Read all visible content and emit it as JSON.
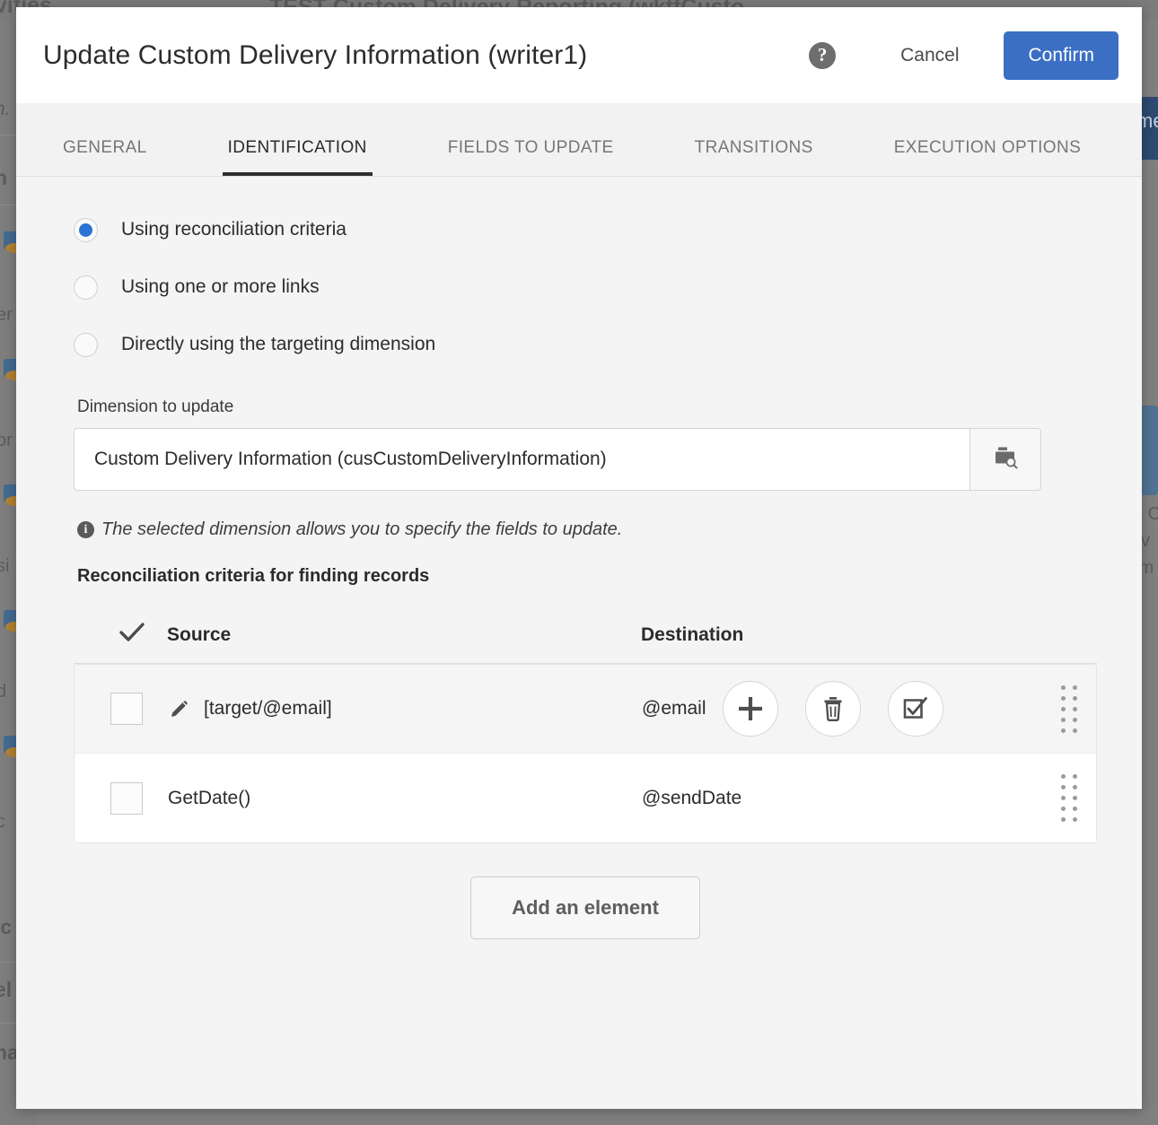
{
  "background": {
    "top_title": "TEST Custom Delivery Reporting (wktfCusto",
    "nav_label": "vities",
    "fragments": [
      "h.",
      "n",
      "er",
      "or",
      "si",
      "d",
      "c",
      "ic",
      "el",
      "na",
      "me",
      "e C",
      "liv",
      "rm"
    ]
  },
  "modal": {
    "title": "Update Custom Delivery Information (writer1)",
    "help_label": "?",
    "cancel_label": "Cancel",
    "confirm_label": "Confirm",
    "tabs": [
      {
        "label": "GENERAL",
        "active": false
      },
      {
        "label": "IDENTIFICATION",
        "active": true
      },
      {
        "label": "FIELDS TO UPDATE",
        "active": false
      },
      {
        "label": "TRANSITIONS",
        "active": false
      },
      {
        "label": "EXECUTION OPTIONS",
        "active": false
      }
    ],
    "radios": [
      {
        "label": "Using reconciliation criteria",
        "checked": true
      },
      {
        "label": "Using one or more links",
        "checked": false
      },
      {
        "label": "Directly using the targeting dimension",
        "checked": false
      }
    ],
    "dimension": {
      "label": "Dimension to update",
      "value": "Custom Delivery Information (cusCustomDeliveryInformation)",
      "placeholder": "",
      "browse_icon": "folder-search-icon"
    },
    "info": {
      "icon": "info-icon",
      "text": "The selected dimension allows you to specify the fields to update."
    },
    "section_title": "Reconciliation criteria for finding records",
    "table": {
      "select_all_icon": "check-icon",
      "columns": [
        "Source",
        "Destination"
      ],
      "rows": [
        {
          "checked": false,
          "edit_icon": "pencil-icon",
          "source": "[target/@email]",
          "destination": "@email",
          "highlight": true,
          "actions": [
            "add-icon",
            "delete-icon",
            "select-icon"
          ]
        },
        {
          "checked": false,
          "edit_icon": "",
          "source": "GetDate()",
          "destination": "@sendDate",
          "highlight": false,
          "actions": []
        }
      ]
    },
    "add_element_label": "Add an element"
  },
  "colors": {
    "accent": "#3a6fc4",
    "radio_selected": "#2a74d4",
    "tab_active_underline": "#2f2f2f",
    "modal_bg": "#f4f4f4",
    "overlay": "#808080"
  }
}
